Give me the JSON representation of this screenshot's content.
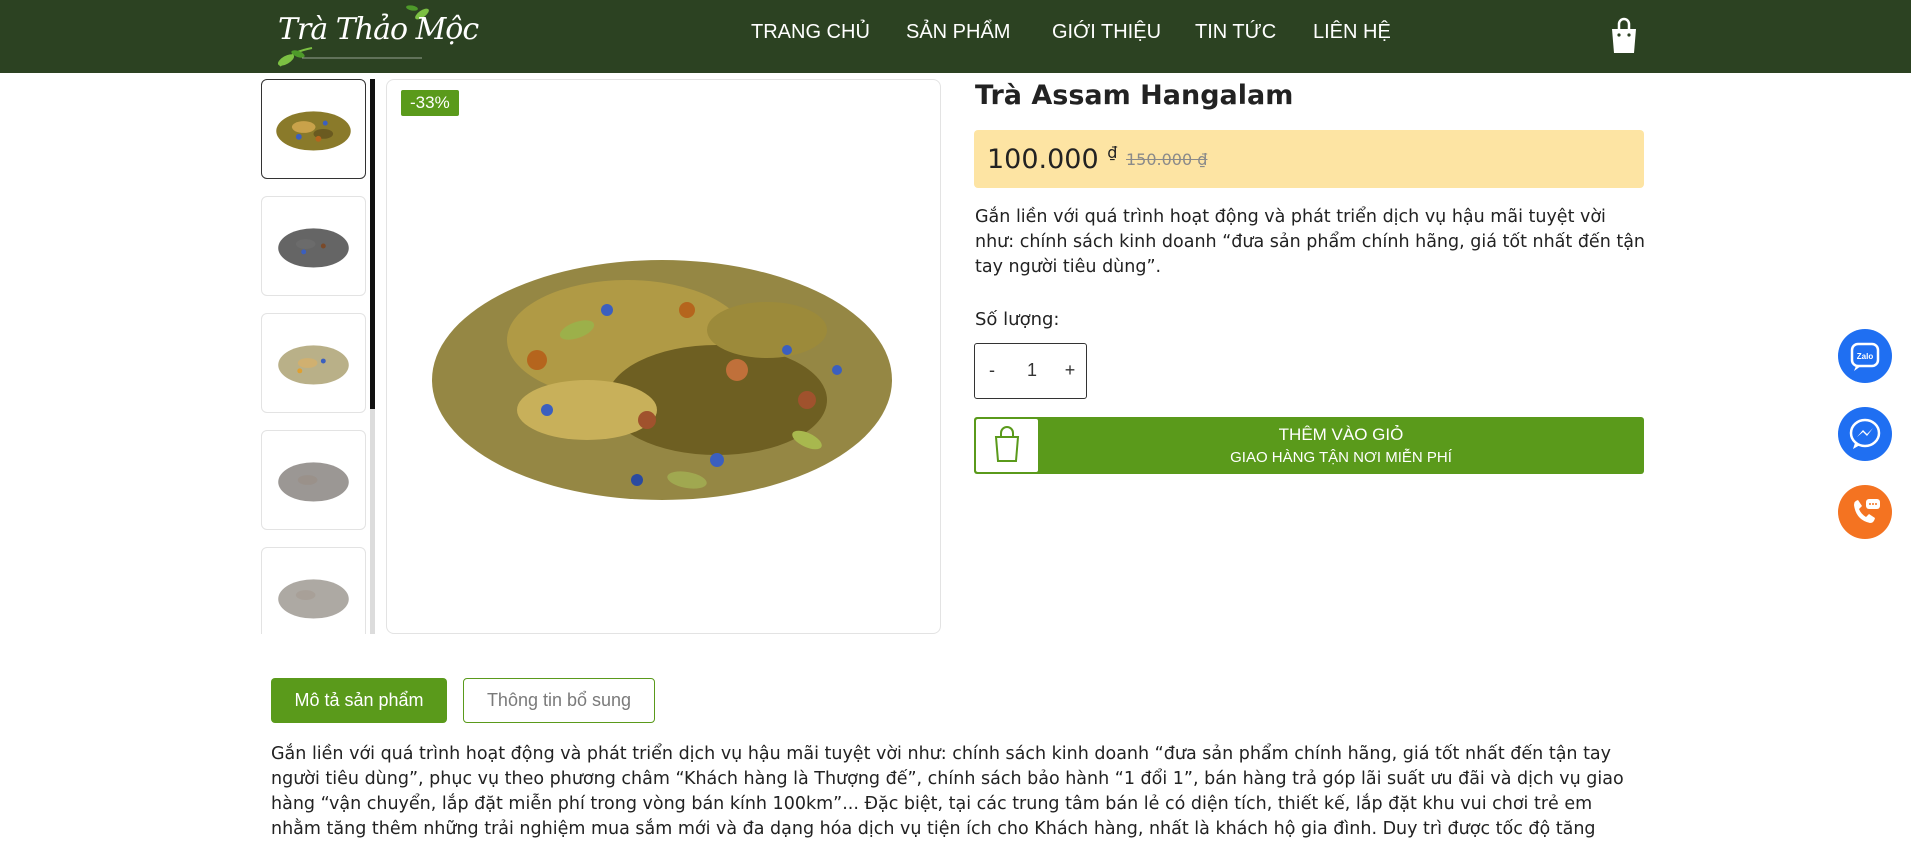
{
  "header": {
    "logo_text": "Trà Thảo Mộc",
    "nav": [
      "TRANG CHỦ",
      "SẢN PHẨM",
      "GIỚI THIỆU",
      "TIN TỨC",
      "LIÊN HỆ"
    ],
    "cart_icon": "shopping-bag-icon",
    "colors": {
      "background": "#2c4222",
      "text": "#ffffff"
    }
  },
  "gallery": {
    "thumbnail_count": 5,
    "active_thumbnail": 1,
    "discount_badge": "-33%"
  },
  "product": {
    "title": "Trà Assam Hangalam",
    "price_current": "100.000",
    "currency_symbol": "₫",
    "price_old": "150.000 ₫",
    "short_description": "Gắn liền với quá trình hoạt động và phát triển  dịch vụ hậu mãi tuyệt vời như: chính sách kinh doanh “đưa sản phẩm chính hãng, giá tốt nhất đến tận tay người tiêu dùng”.",
    "quantity_label": "Số lượng:",
    "quantity": {
      "minus": "-",
      "value": "1",
      "plus": "+"
    },
    "add_to_cart": {
      "title": "THÊM VÀO GIỎ",
      "subtitle": "GIAO HÀNG TẬN NƠI MIỄN PHÍ",
      "icon": "shopping-bag-icon"
    },
    "colors": {
      "accent_green": "#5a9a1b",
      "price_box": "#fde4a3"
    }
  },
  "floating_contacts": [
    {
      "name": "zalo",
      "label": "Zalo",
      "color": "#1f6ff2"
    },
    {
      "name": "messenger",
      "label": "",
      "color": "#1f6ff2"
    },
    {
      "name": "phone",
      "label": "",
      "color": "#f47321"
    }
  ],
  "tabs": {
    "items": [
      "Mô tả sản phẩm",
      "Thông tin bổ sung"
    ],
    "active_index": 0
  },
  "description": {
    "text": "Gắn liền với quá trình hoạt động và phát triển  dịch vụ hậu mãi tuyệt vời như: chính sách kinh doanh “đưa sản phẩm chính hãng, giá tốt nhất đến tận tay người tiêu dùng”, phục vụ theo phương châm “Khách hàng là Thượng đế”, chính sách bảo hành “1 đổi 1”, bán hàng trả góp lãi suất ưu đãi và dịch vụ giao hàng “vận chuyển, lắp đặt miễn phí trong vòng bán kính 100km”... Đặc biệt, tại các trung tâm bán lẻ có diện tích,  thiết kế, lắp đặt khu vui chơi trẻ em nhằm tăng thêm những trải nghiệm mua sắm mới và đa dạng hóa dịch vụ tiện ích cho Khách hàng, nhất là khách hộ gia đình. Duy trì được tốc độ tăng trưởng cao, toàn diện về mọi mặt một cách bền"
  }
}
